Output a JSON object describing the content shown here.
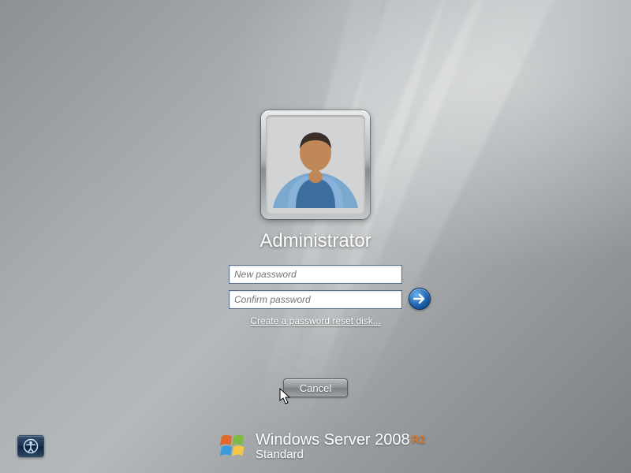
{
  "user": {
    "name": "Administrator"
  },
  "fields": {
    "new_password_placeholder": "New password",
    "confirm_password_placeholder": "Confirm password"
  },
  "links": {
    "reset_disk": "Create a password reset disk..."
  },
  "buttons": {
    "cancel": "Cancel"
  },
  "branding": {
    "product_prefix": "Windows Server",
    "year": "2008",
    "suffix": "R2",
    "edition": "Standard"
  }
}
